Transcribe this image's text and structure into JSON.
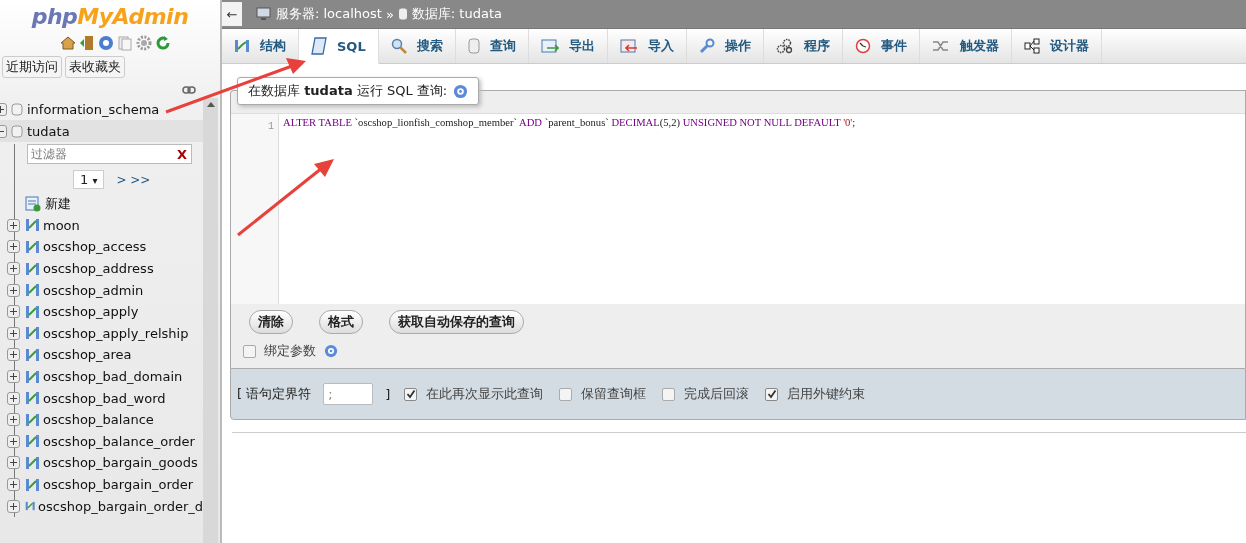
{
  "sidebar": {
    "logo": {
      "part1": "php",
      "part2": "MyAdmin"
    },
    "nav_buttons": [
      {
        "label": "近期访问"
      },
      {
        "label": "表收藏夹"
      }
    ],
    "databases": [
      {
        "name": "information_schema",
        "expanded": false
      },
      {
        "name": "tudata",
        "expanded": true,
        "filter": {
          "placeholder": "过滤器",
          "clear": "X"
        },
        "page": "1",
        "page_caret": "▾",
        "page_nav": "> >>",
        "new_label": "新建",
        "tables": [
          "moon",
          "oscshop_access",
          "oscshop_address",
          "oscshop_admin",
          "oscshop_apply",
          "oscshop_apply_relship",
          "oscshop_area",
          "oscshop_bad_domain",
          "oscshop_bad_word",
          "oscshop_balance",
          "oscshop_balance_order",
          "oscshop_bargain_goods",
          "oscshop_bargain_order",
          "oscshop_bargain_order_d"
        ]
      }
    ]
  },
  "breadcrumb": {
    "back": "←",
    "server": "服务器: localhost",
    "separator": "»",
    "database": "数据库: tudata"
  },
  "tabs": [
    {
      "label": "结构",
      "kind": "structure",
      "selected": false
    },
    {
      "label": "SQL",
      "kind": "sql",
      "selected": true
    },
    {
      "label": "搜索",
      "kind": "search",
      "selected": false
    },
    {
      "label": "查询",
      "kind": "query",
      "selected": false
    },
    {
      "label": "导出",
      "kind": "export",
      "selected": false
    },
    {
      "label": "导入",
      "kind": "import",
      "selected": false
    },
    {
      "label": "操作",
      "kind": "operations",
      "selected": false
    },
    {
      "label": "程序",
      "kind": "routines",
      "selected": false
    },
    {
      "label": "事件",
      "kind": "events",
      "selected": false
    },
    {
      "label": "触发器",
      "kind": "triggers",
      "selected": false
    },
    {
      "label": "设计器",
      "kind": "designer",
      "selected": false
    }
  ],
  "query_panel": {
    "title": "在数据库 **tudata** 运行 SQL 查询:",
    "editor": {
      "line_number": "1",
      "tokens": [
        {
          "text": "ALTER TABLE",
          "kind": "keyword"
        },
        {
          "text": " `oscshop_lionfish_comshop_member` ",
          "kind": "name"
        },
        {
          "text": "ADD",
          "kind": "keyword"
        },
        {
          "text": " `parent_bonus` ",
          "kind": "name"
        },
        {
          "text": "DECIMAL",
          "kind": "keyword"
        },
        {
          "text": "(5,2) ",
          "kind": "plain"
        },
        {
          "text": "UNSIGNED NOT NULL DEFAULT",
          "kind": "keyword"
        },
        {
          "text": " '0'",
          "kind": "string"
        },
        {
          "text": ";",
          "kind": "plain"
        }
      ]
    },
    "buttons": [
      "清除",
      "格式",
      "获取自动保存的查询"
    ],
    "bind_parameters": {
      "label": "绑定参数",
      "checked": false
    }
  },
  "options": {
    "delimiter_open": "[ 语句定界符",
    "delimiter_value": ";",
    "delimiter_close": "]",
    "checkboxes": [
      {
        "label": "在此再次显示此查询",
        "checked": true
      },
      {
        "label": "保留查询框",
        "checked": false
      },
      {
        "label": "完成后回滚",
        "checked": false
      },
      {
        "label": "启用外键约束",
        "checked": true
      }
    ]
  }
}
